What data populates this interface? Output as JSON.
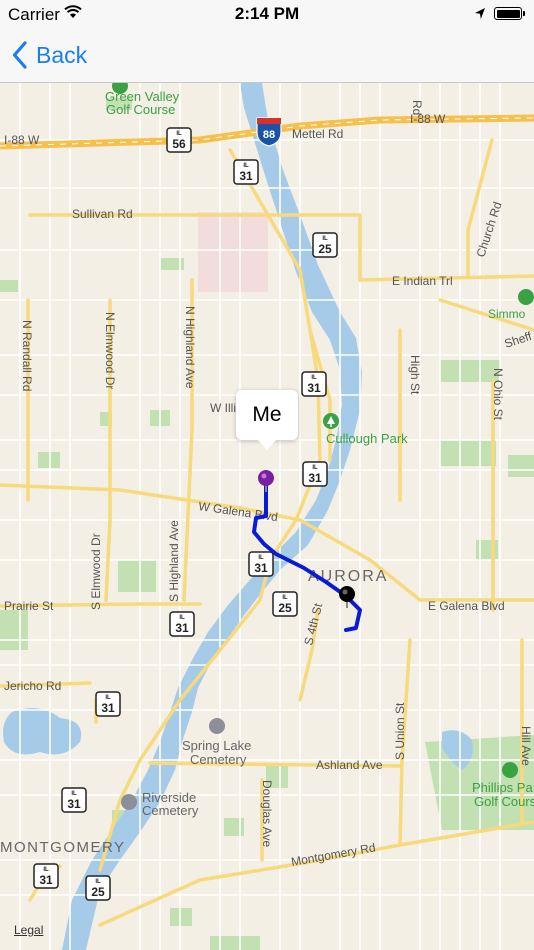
{
  "status_bar": {
    "carrier": "Carrier",
    "time": "2:14 PM"
  },
  "nav": {
    "back_label": "Back"
  },
  "callout": {
    "label": "Me"
  },
  "legal": "Legal",
  "map_labels": {
    "green_valley": "Green Valley",
    "golf_course": "Golf Course",
    "i88_w": "I-88 W",
    "i88_w_2": "I-88 W",
    "mettel_rd": "Mettel Rd",
    "sullivan_rd": "Sullivan Rd",
    "e_indian_trl": "E Indian Trl",
    "church_rd": "Church Rd",
    "simmons": "Simmo",
    "sheff": "Sheff",
    "n_randall_rd": "N Randall Rd",
    "n_elmwood_dr": "N Elmwood Dr",
    "n_highland_ave": "N Highland Ave",
    "high_st": "High St",
    "n_ohio_st": "N Ohio St",
    "w_illinois": "W Illi",
    "mccullough_park": "Cullough Park",
    "w_galena_blvd": "W Galena Blvd",
    "aurora": "AURORA",
    "s_elmwood_dr": "S Elmwood Dr",
    "s_highland_ave": "S Highland Ave",
    "prairie_st": "Prairie St",
    "s_4th_st": "S 4th St",
    "e_galena_blvd": "E Galena Blvd",
    "jericho_rd": "Jericho Rd",
    "s_union_st": "S Union St",
    "hill_ave": "Hill Ave",
    "spring_lake": "Spring Lake",
    "cemetery": "Cemetery",
    "ashland_ave": "Ashland Ave",
    "phillips_park": "Phillips Pa",
    "golf_cours": "Golf Cours",
    "riverside": "Riverside",
    "cemetery_2": "Cemetery",
    "douglas_ave": "Douglas Ave",
    "montgomery": "MONTGOMERY",
    "montgomery_rd": "Montgomery Rd",
    "rd": "Rd"
  },
  "shields": {
    "il56": "56",
    "il31_a": "31",
    "il25_a": "25",
    "il31_b": "31",
    "il31_c": "31",
    "il31_d": "31",
    "il25_b": "25",
    "il31_e": "31",
    "il31_f": "31",
    "il31_g": "31",
    "il31_h": "31",
    "il25_c": "25",
    "i88": "88",
    "il": "IL"
  },
  "colors": {
    "land": "#f4efe4",
    "water": "#a5cbe9",
    "park": "#c2e0b2",
    "arterial": "#f7d97e",
    "interstate": "#f6c04d",
    "route": "#0a1bd6",
    "me_pin": "#7b1fa2",
    "dest_pin": "#000000",
    "poi": "#3aa144",
    "label": "#555555",
    "back": "#1a7cf6"
  }
}
